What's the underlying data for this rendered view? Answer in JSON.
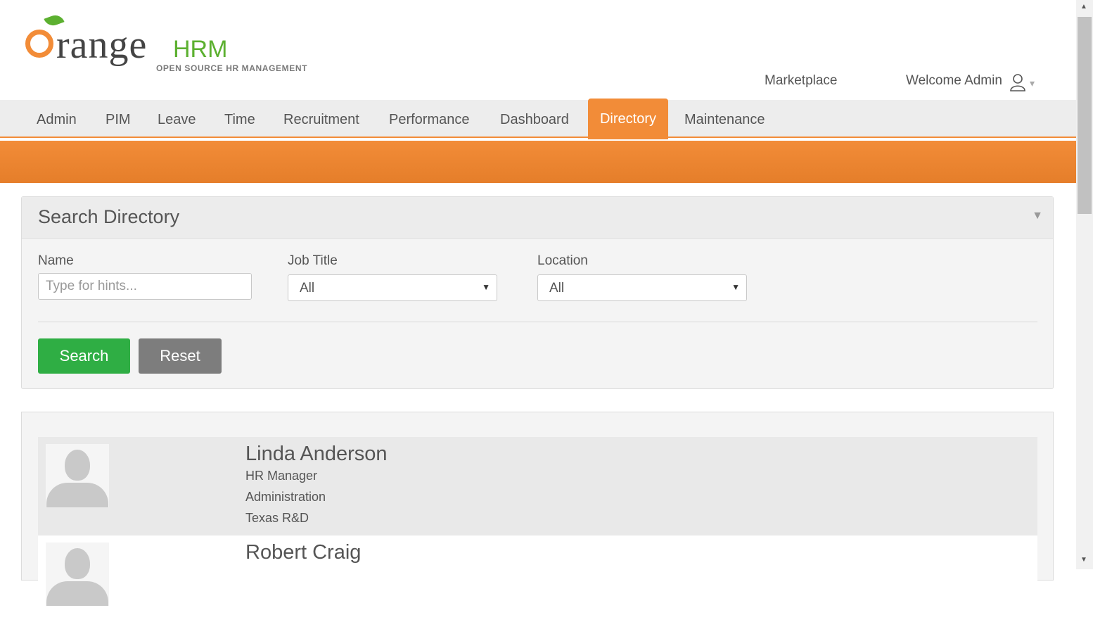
{
  "brand": {
    "word": "range",
    "accent": "HRM",
    "tagline": "OPEN SOURCE HR MANAGEMENT",
    "colors": {
      "orange": "#f28c38",
      "green": "#5cb030"
    }
  },
  "header": {
    "marketplace_label": "Marketplace",
    "welcome_label": "Welcome Admin",
    "user_icon": "user-icon",
    "caret": "▾"
  },
  "nav": {
    "items": [
      {
        "label": "Admin"
      },
      {
        "label": "PIM"
      },
      {
        "label": "Leave"
      },
      {
        "label": "Time"
      },
      {
        "label": "Recruitment"
      },
      {
        "label": "Performance"
      },
      {
        "label": "Dashboard"
      },
      {
        "label": "Directory",
        "active": true
      },
      {
        "label": "Maintenance"
      }
    ]
  },
  "search_panel": {
    "title": "Search Directory",
    "toggle_icon": "▼",
    "name_label": "Name",
    "name_placeholder": "Type for hints...",
    "job_title_label": "Job Title",
    "job_title_value": "All",
    "location_label": "Location",
    "location_value": "All",
    "select_arrow": "▼",
    "search_button": "Search",
    "reset_button": "Reset"
  },
  "results": [
    {
      "name": "Linda Anderson",
      "job_title": "HR Manager",
      "department": "Administration",
      "location": "Texas R&D"
    },
    {
      "name": "Robert Craig"
    }
  ],
  "scrollbar": {
    "up": "▲",
    "down": "▼"
  }
}
